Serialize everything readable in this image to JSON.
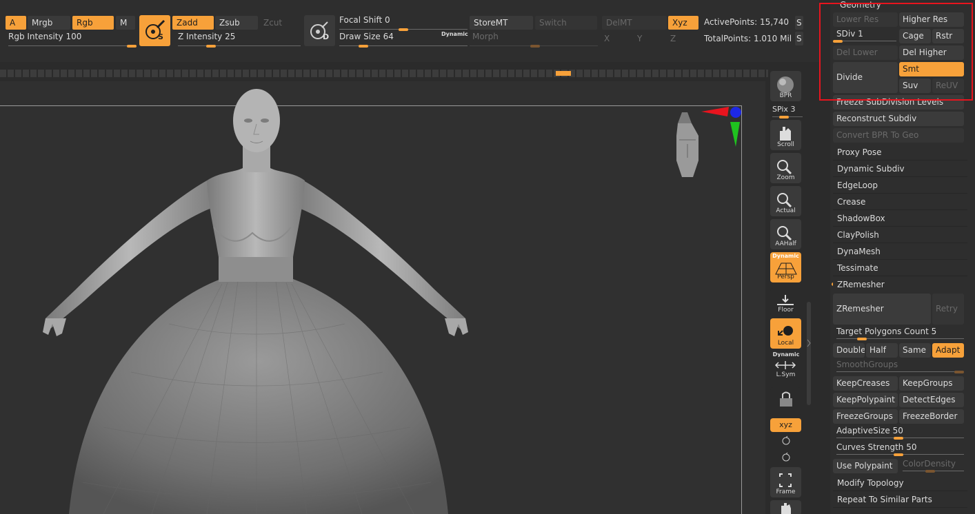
{
  "toolbar": {
    "a": "A",
    "mrgb": "Mrgb",
    "rgb": "Rgb",
    "m": "M",
    "rgb_intensity_label": "Rgb Intensity",
    "rgb_intensity_value": "100",
    "rgb_intensity_level": 1.0,
    "zadd": "Zadd",
    "zsub": "Zsub",
    "zcut": "Zcut",
    "z_intensity_label": "Z Intensity",
    "z_intensity_value": "25",
    "z_intensity_level": 0.25,
    "s_badge": "S",
    "d_badge": "D",
    "focal_shift_label": "Focal Shift",
    "focal_shift_value": "0",
    "focal_shift_level": 0.5,
    "draw_size_label": "Draw Size",
    "draw_size_value": "64",
    "draw_size_level": 0.16,
    "dynamic": "Dynamic",
    "storemt": "StoreMT",
    "switch": "Switch",
    "morph": "Morph",
    "delmt": "DelMT",
    "xyz": "Xyz",
    "x": "X",
    "y": "Y",
    "z": "Z",
    "s_cut": "S",
    "active_points_label": "ActivePoints:",
    "active_points_value": "15,740",
    "total_points_label": "TotalPoints:",
    "total_points_value": "1.010 Mil"
  },
  "shelf": {
    "bpr": "BPR",
    "spix_label": "SPix",
    "spix_value": "3",
    "scroll": "Scroll",
    "zoom": "Zoom",
    "actual": "Actual",
    "aahalf": "AAHalf",
    "dynamic": "Dynamic",
    "persp": "Persp",
    "floor": "Floor",
    "local": "Local",
    "lsym": "L.Sym",
    "xyz": "xyz",
    "frame": "Frame"
  },
  "palette": {
    "geometry": "Geometry",
    "lower_res": "Lower Res",
    "higher_res": "Higher Res",
    "sdiv_label": "SDiv",
    "sdiv_value": "1",
    "sdiv_level": 0.0,
    "cage": "Cage",
    "rstr": "Rstr",
    "del_lower": "Del Lower",
    "del_higher": "Del Higher",
    "divide": "Divide",
    "smt": "Smt",
    "suv": "Suv",
    "reuv": "ReUV",
    "freeze_subdivision": "Freeze SubDivision Levels",
    "reconstruct_subdiv": "Reconstruct Subdiv",
    "convert_bpr": "Convert BPR To Geo",
    "sections": [
      "Proxy Pose",
      "Dynamic Subdiv",
      "EdgeLoop",
      "Crease",
      "ShadowBox",
      "ClayPolish",
      "DynaMesh",
      "Tessimate"
    ],
    "zremesher_header": "ZRemesher",
    "zremesher_button": "ZRemesher",
    "retry": "Retry",
    "target_polygons_label": "Target Polygons Count",
    "target_polygons_value": "5",
    "target_polygons_level": 0.2,
    "double": "Double",
    "half": "Half",
    "same": "Same",
    "adapt": "Adapt",
    "smoothgroups": "SmoothGroups",
    "keepcreases": "KeepCreases",
    "keepgroups": "KeepGroups",
    "keeppolypaint": "KeepPolypaint",
    "detectedges": "DetectEdges",
    "freezegroups": "FreezeGroups",
    "freezeborder": "FreezeBorder",
    "adaptivesize_label": "AdaptiveSize",
    "adaptivesize_value": "50",
    "adaptivesize_level": 0.5,
    "curves_strength_label": "Curves Strength",
    "curves_strength_value": "50",
    "curves_strength_level": 0.5,
    "use_polypaint": "Use Polypaint",
    "colordensity": "ColorDensity",
    "modify_topology": "Modify Topology",
    "repeat_similar": "Repeat To Similar Parts"
  },
  "colors": {
    "accent": "#f7a13a",
    "panel": "#2e2e2e",
    "button": "#3b3b3b",
    "highlight_box": "#e8141e"
  }
}
